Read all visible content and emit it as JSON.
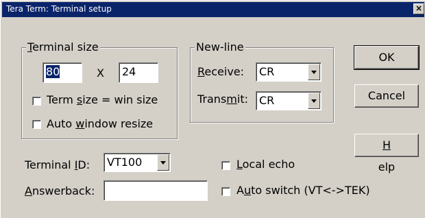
{
  "window": {
    "title": "Tera Term: Terminal setup",
    "close_glyph": "×"
  },
  "terminal_size": {
    "group_title_prefix": "",
    "group_title_accel": "T",
    "group_title_rest": "erminal size",
    "width_value": "80",
    "separator": "X",
    "height_value": "24",
    "term_size_label_a": "Term ",
    "term_size_label_accel": "s",
    "term_size_label_b": "ize = win size",
    "auto_resize_label_a": "Auto ",
    "auto_resize_label_accel": "w",
    "auto_resize_label_b": "indow resize"
  },
  "new_line": {
    "group_title": "New-line",
    "receive_accel": "R",
    "receive_rest": "eceive:",
    "receive_value": "CR",
    "transmit_a": "Trans",
    "transmit_accel": "m",
    "transmit_b": "it:",
    "transmit_value": "CR"
  },
  "buttons": {
    "ok": "OK",
    "cancel": "Cancel",
    "help_accel": "H",
    "help_rest": "elp"
  },
  "terminal_id": {
    "label_a": "Terminal ",
    "label_accel": "I",
    "label_b": "D:",
    "value": "VT100"
  },
  "answerback": {
    "label_accel": "A",
    "label_rest": "nswerback:",
    "value": ""
  },
  "local_echo": {
    "label_accel": "L",
    "label_rest": "ocal echo"
  },
  "auto_switch": {
    "label_a": "A",
    "label_accel": "u",
    "label_b": "to switch (VT<->TEK)"
  }
}
